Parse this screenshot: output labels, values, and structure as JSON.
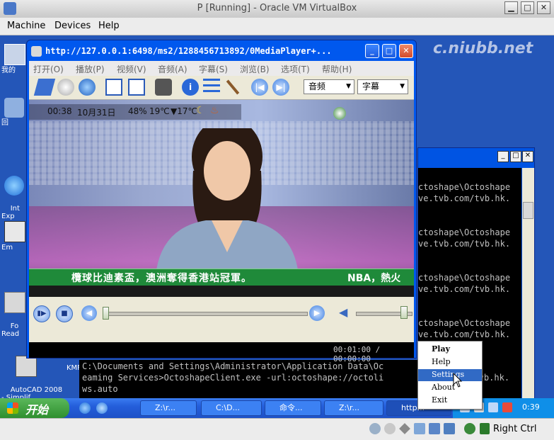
{
  "host": {
    "title": "P [Running] - Oracle VM VirtualBox",
    "menu": [
      "Machine",
      "Devices",
      "Help"
    ],
    "status_text": "Right Ctrl"
  },
  "watermark": "c.niubb.net",
  "desktop_icons": [
    {
      "label": "我的",
      "icon": "my-computer-icon"
    },
    {
      "label": "回",
      "icon": "recycle-bin-icon"
    },
    {
      "label": "Int\nExp",
      "icon": "internet-explorer-icon"
    },
    {
      "label": "Em",
      "icon": "email-icon"
    },
    {
      "label": "Fo\nRead",
      "icon": "reader-icon"
    },
    {
      "label": "AutoCAD 2008\n- Simplif...",
      "icon": "autocad-icon"
    }
  ],
  "desktop_extra_label": "KMF",
  "player": {
    "title": "http://127.0.0.1:6498/ms2/1288456713892/0MediaPlayer+...",
    "menu": [
      "打开(O)",
      "播放(P)",
      "视频(V)",
      "音频(A)",
      "字幕(S)",
      "浏览(B)",
      "选项(T)",
      "帮助(H)"
    ],
    "audio_dropdown": "音频",
    "subtitle_dropdown": "字幕",
    "osd": {
      "time": "00:38",
      "date": "10月31日",
      "humidity": "48%",
      "temp_high": "19℃",
      "temp_low": "▼17℃"
    },
    "ticker": "欖球比迪素盃，澳洲奪得香港站冠軍。",
    "ticker_right": "NBA，熱火",
    "time_display": "00:01:00 / 00:00:00",
    "seek_position": 0.0,
    "volume_level": 0.92
  },
  "console": {
    "lines": [
      "ctoshape\\Octoshape",
      "ve.tvb.com/tvb.hk.",
      "ctoshape\\Octoshape",
      "ve.tvb.com/tvb.hk.",
      "ctoshape\\Octoshape",
      "ve.tvb.com/tvb.hk.",
      "ctoshape\\Octoshape",
      "ve.tvb.com/tvb.hk."
    ],
    "cmd_lines": [
      "C:\\Documents and Settings\\Administrator\\Application Data\\Oc",
      "eaming Services>OctoshapeClient.exe -url:octoshape://octoli",
      "ws.auto"
    ],
    "cmd_right": [
      "ctoshape",
      "ve.tvb.com/tvb.hk."
    ]
  },
  "context_menu": {
    "items": [
      "Play",
      "Help",
      "Settings",
      "About",
      "Exit"
    ],
    "highlighted": "Settings"
  },
  "taskbar": {
    "start_label": "开始",
    "tasks": [
      "Z:\\r...",
      "C:\\D...",
      "命令...",
      "Z:\\r...",
      "http..."
    ],
    "clock": "0:39"
  },
  "colors": {
    "desktop": "#2456b8",
    "xp_blue": "#0058ee",
    "highlight": "#316ac5",
    "ticker_bg": "#1f8a3a"
  }
}
